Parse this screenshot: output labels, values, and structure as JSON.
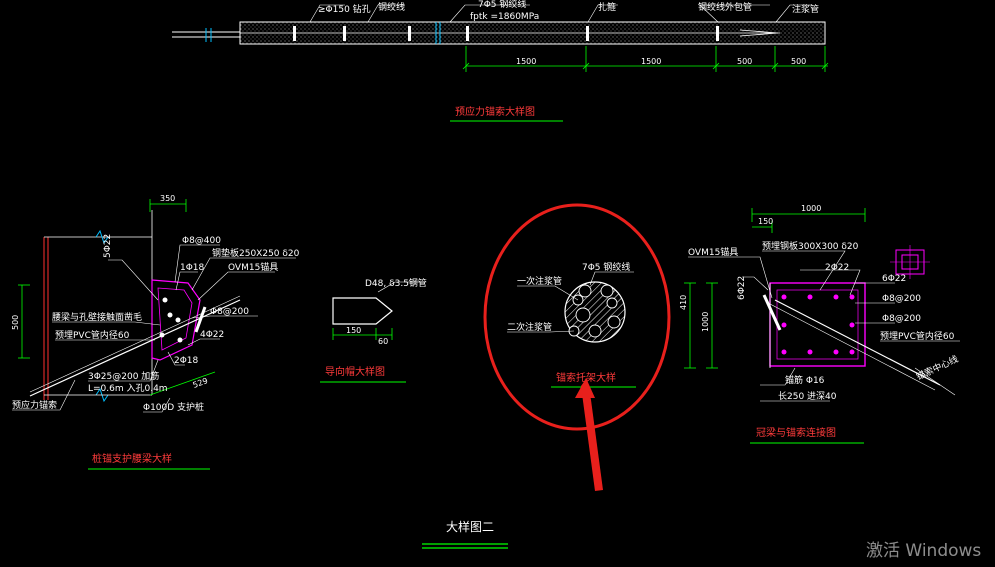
{
  "colors": {
    "background": "#000000",
    "line": "#ffffff",
    "dimension": "#00ff00",
    "section": "#ff00ff",
    "title": "#ff3b3b",
    "highlight_circle": "#e8201c",
    "arrow": "#e8201c"
  },
  "top_detail": {
    "labels": {
      "hole": "≥Φ150 钻孔",
      "strand_line": "钢绞线",
      "strand_spec": "7Φ5 钢绞线",
      "strength": "fptk =1860MPa",
      "spacer": "扎箍",
      "sleeve": "钢绞线外包管",
      "grout": "注浆管"
    },
    "dims": [
      "1500",
      "1500",
      "500",
      "500"
    ],
    "title": "预应力锚索大样图"
  },
  "left_detail": {
    "dims": {
      "top": "350",
      "height": "500",
      "slope": "529"
    },
    "labels": {
      "a": "Φ8@400",
      "b": "钢垫板250X250 δ20",
      "c": "1Φ18",
      "d": "OVM15锚具",
      "e": "5Φ22",
      "f": "腰梁与孔壁接触面凿毛",
      "g": "Φ8@200",
      "h": "预埋PVC管内径60",
      "i": "4Φ22",
      "j": "2Φ18",
      "k": "3Φ25@200 加筋",
      "l": "L=0.6m 入孔0.4m",
      "m": "Φ100D 支护桩",
      "n": "预应力锚索"
    },
    "title": "桩锚支护腰梁大样"
  },
  "guide_cap": {
    "label": "D48, δ3.5钢管",
    "dims": [
      "150",
      "60"
    ],
    "title": "导向帽大样图"
  },
  "section_detail": {
    "labels": {
      "strand": "7Φ5 钢绞线",
      "grout1": "一次注浆管",
      "grout2": "二次注浆管"
    },
    "title": "锚索托架大样"
  },
  "right_detail": {
    "dims": {
      "top": "1000",
      "small": "150",
      "side_a": "410",
      "side_b": "1000"
    },
    "labels": {
      "a": "OVM15锚具",
      "b": "预埋钢板300X300 δ20",
      "c": "6Φ22",
      "d": "2Φ22",
      "e": "6Φ22",
      "f": "Φ8@200",
      "g": "Φ8@200",
      "h": "预埋PVC管内径60",
      "i": "锚索中心线",
      "j": "锚筋 Φ16",
      "k": "长250 进深40"
    },
    "title": "冠梁与锚索连接图"
  },
  "sheet_title": "大样图二",
  "watermark": "激活 Windows"
}
